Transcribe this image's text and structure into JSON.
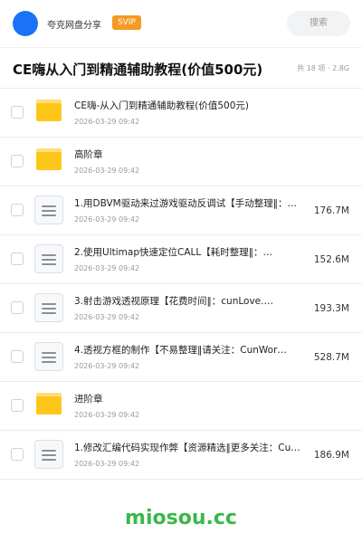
{
  "header": {
    "share_name": "夸克网盘分享",
    "badge": "SVIP",
    "search_placeholder": "搜索"
  },
  "title_bar": {
    "title": "CE嗨从入门到精通辅助教程(价值500元)",
    "meta": "共 18 项 · 2.8G"
  },
  "items": [
    {
      "type": "folder",
      "name": "CE嗨-从入门到精通辅助教程(价值500元)",
      "date": "2026-03-29 09:42",
      "size": ""
    },
    {
      "type": "folder",
      "name": "高阶章",
      "date": "2026-03-29 09:42",
      "size": ""
    },
    {
      "type": "file",
      "name": "1.用DBVM驱动来过游戏驱动反调试【手动整理‖：…",
      "date": "2026-03-29 09:42",
      "size": "176.7M"
    },
    {
      "type": "file",
      "name": "2.使用Ultimap快速定位CALL【耗时整理‖：…",
      "date": "2026-03-29 09:42",
      "size": "152.6M"
    },
    {
      "type": "file",
      "name": "3.射击游戏透视原理【花费时间‖：cunLove.…",
      "date": "2026-03-29 09:42",
      "size": "193.3M"
    },
    {
      "type": "file",
      "name": "4.透视方框的制作【不易整理‖请关注：CunWor…",
      "date": "2026-03-29 09:42",
      "size": "528.7M"
    },
    {
      "type": "folder",
      "name": "进阶章",
      "date": "2026-03-29 09:42",
      "size": ""
    },
    {
      "type": "file",
      "name": "1.修改汇编代码实现作弊【资源精选‖更多关注：Cu…",
      "date": "2026-03-29 09:42",
      "size": "186.9M"
    }
  ],
  "footer": {
    "watermark": "miosou.cc"
  },
  "colors": {
    "accent": "#1a73f5",
    "svip": "#f59a23",
    "folder": "#ffc61a",
    "watermark": "#3ab84a"
  }
}
